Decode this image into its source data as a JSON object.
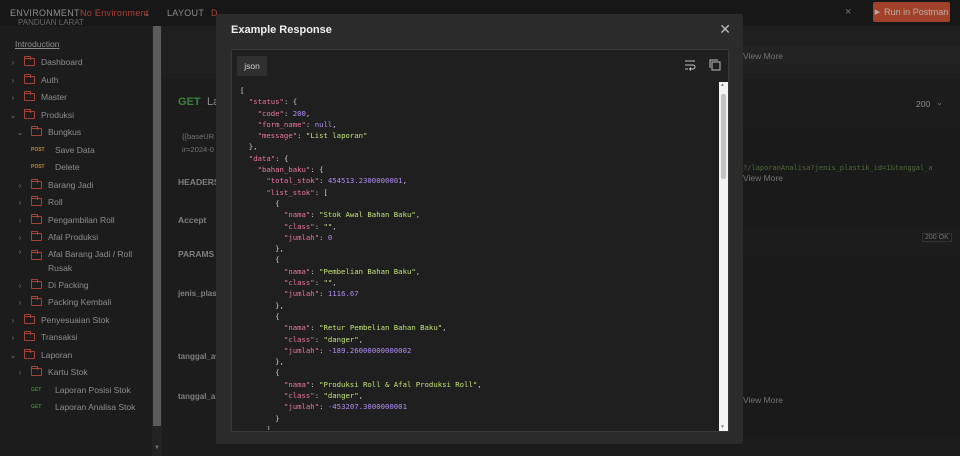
{
  "topbar": {
    "env_label": "ENVIRONMENT",
    "env_value": "No Environment",
    "layout_label": "LAYOUT",
    "layout_cut": "D",
    "run_label": "Run in Postman"
  },
  "sidebar": {
    "header_cut": "PANDUAN LARAT",
    "intro": "Introduction",
    "items": [
      {
        "label": "Dashboard"
      },
      {
        "label": "Auth"
      },
      {
        "label": "Master"
      },
      {
        "label": "Produksi"
      },
      {
        "label": "Bungkus"
      },
      {
        "label": "Save Data",
        "method": "POST"
      },
      {
        "label": "Delete",
        "method": "POST"
      },
      {
        "label": "Barang Jadi"
      },
      {
        "label": "Roll"
      },
      {
        "label": "Pengambilan Roll"
      },
      {
        "label": "Afal Produksi"
      },
      {
        "label": "Afal Barang Jadi / Roll",
        "label2": "Rusak"
      },
      {
        "label": "Di Packing"
      },
      {
        "label": "Packing Kembali"
      },
      {
        "label": "Penyesuaian Stok"
      },
      {
        "label": "Transaksi"
      },
      {
        "label": "Laporan"
      },
      {
        "label": "Kartu Stok"
      },
      {
        "label": "Laporan Posisi Stok",
        "method": "GET"
      },
      {
        "label": "Laporan Analisa Stok",
        "method": "GET"
      }
    ]
  },
  "background": {
    "method": "GET",
    "title_cut": "La",
    "url1": "{{baseUR",
    "url2": "ir=2024-0",
    "headers": "HEADERS",
    "accept": "Accept",
    "params": "PARAMS",
    "p1": "jenis_plast",
    "p2": "tanggal_aw",
    "p3": "tanggal_ak",
    "view_more": "View More",
    "status_code": "200",
    "curl_snip": "?/laporanAnalisa?jenis_plastik_id=1&tanggal_a",
    "ok_badge": "200 OK"
  },
  "modal": {
    "title": "Example Response",
    "lang_tab": "json",
    "json": {
      "k_status": "\"status\"",
      "k_code": "\"code\"",
      "v_code": "200",
      "k_form": "\"form_name\"",
      "v_form": "null",
      "k_message": "\"message\"",
      "v_message": "\"List laporan\"",
      "k_data": "\"data\"",
      "k_bahan": "\"bahan_baku\"",
      "k_total": "\"total_stok\"",
      "v_total": "454513.2300000001",
      "k_list": "\"list_stok\"",
      "k_nama": "\"nama\"",
      "k_class": "\"class\"",
      "k_jumlah": "\"jumlah\"",
      "rows": [
        {
          "nama": "\"Stok Awal Bahan Baku\"",
          "class": "\"\"",
          "jumlah": "0"
        },
        {
          "nama": "\"Pembelian Bahan Baku\"",
          "class": "\"\"",
          "jumlah": "1116.67"
        },
        {
          "nama": "\"Retur Pembelian Bahan Baku\"",
          "class": "\"danger\"",
          "jumlah": "-189.26000000000002"
        },
        {
          "nama": "\"Produksi Roll & Afal Produksi Roll\"",
          "class": "\"danger\"",
          "jumlah": "-453207.3000000001"
        }
      ]
    }
  },
  "colors": {
    "accent": "#d8593a",
    "folder": "#e0584a",
    "get": "#4caf50",
    "post": "#f2b24a",
    "json_key": "#ef76a4",
    "json_string": "#c5e478",
    "json_number": "#b18cf4"
  }
}
